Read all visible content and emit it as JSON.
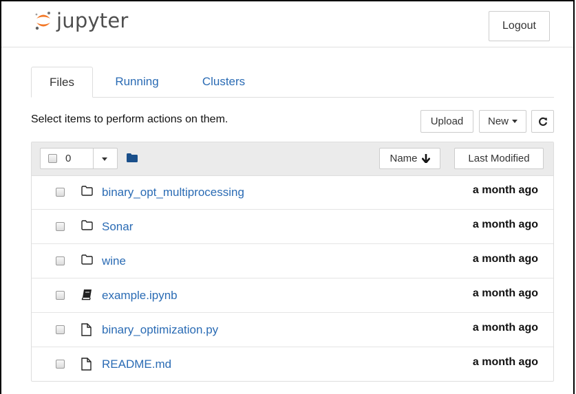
{
  "header": {
    "logo_text": "jupyter",
    "logout_label": "Logout"
  },
  "tabs": [
    {
      "label": "Files",
      "active": true
    },
    {
      "label": "Running",
      "active": false
    },
    {
      "label": "Clusters",
      "active": false
    }
  ],
  "toolbar": {
    "hint": "Select items to perform actions on them.",
    "upload_label": "Upload",
    "new_label": "New",
    "refresh_icon": "refresh-icon"
  },
  "list_header": {
    "selected_count": "0",
    "name_sort_label": "Name",
    "name_sort_icon": "arrow-down-icon",
    "last_modified_label": "Last Modified"
  },
  "files": [
    {
      "name": "binary_opt_multiprocessing",
      "type": "folder",
      "modified": "a month ago"
    },
    {
      "name": "Sonar",
      "type": "folder",
      "modified": "a month ago"
    },
    {
      "name": "wine",
      "type": "folder",
      "modified": "a month ago"
    },
    {
      "name": "example.ipynb",
      "type": "notebook",
      "modified": "a month ago"
    },
    {
      "name": "binary_optimization.py",
      "type": "file",
      "modified": "a month ago"
    },
    {
      "name": "README.md",
      "type": "file",
      "modified": "a month ago"
    }
  ],
  "colors": {
    "link": "#2a6bb4",
    "jupyter_orange": "#f37726",
    "header_bg": "#ebebeb"
  }
}
